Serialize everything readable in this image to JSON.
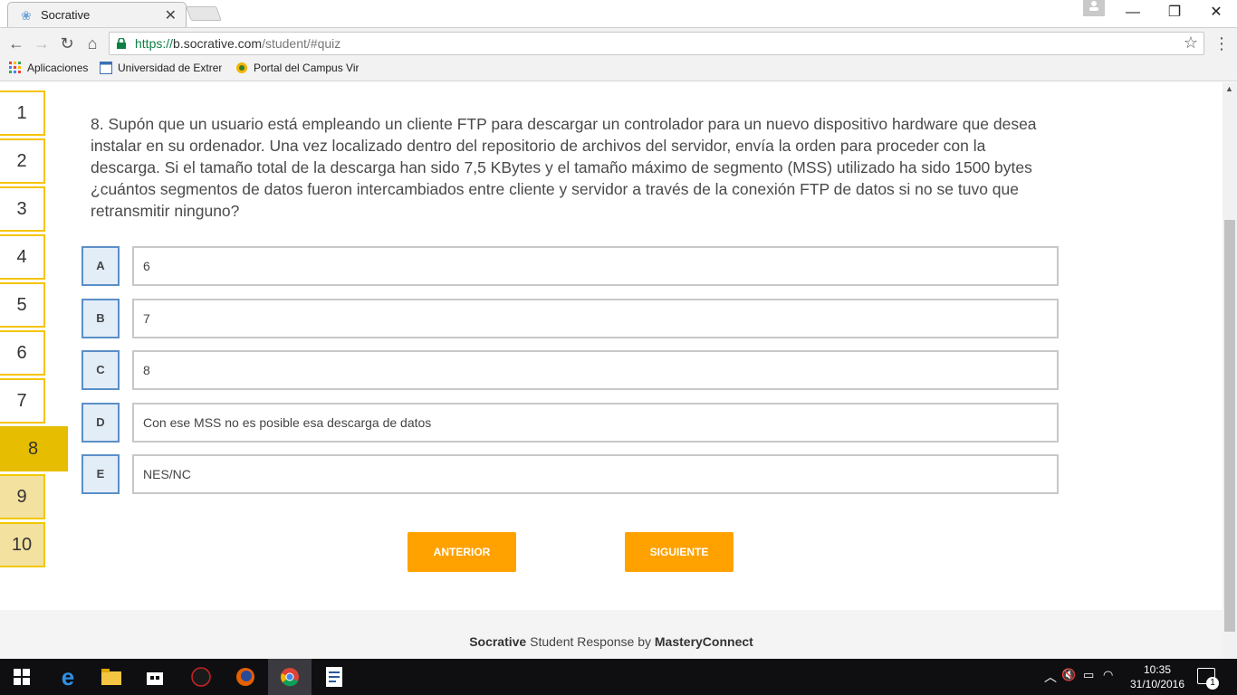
{
  "browser": {
    "tab_title": "Socrative",
    "tab_close": "✕",
    "url_scheme": "https://",
    "url_host": "b.socrative.com",
    "url_path": "/student/#quiz",
    "bookmarks": [
      {
        "label": "Aplicaciones"
      },
      {
        "label": "Universidad de Extrem"
      },
      {
        "label": "Portal del Campus Vir"
      }
    ],
    "win_min": "—",
    "win_max": "❐",
    "win_close": "✕"
  },
  "quiz_nav": [
    "1",
    "2",
    "3",
    "4",
    "5",
    "6",
    "7",
    "8",
    "9",
    "10"
  ],
  "current_question": 8,
  "question": {
    "text": "8. Supón que un usuario está empleando un cliente FTP para descargar un controlador para un nuevo dispositivo hardware que desea instalar en su ordenador. Una vez localizado dentro del repositorio de archivos del servidor, envía la orden para proceder con la descarga. Si el tamaño total de la descarga han sido 7,5 KBytes y el tamaño máximo de segmento (MSS) utilizado ha sido 1500 bytes ¿cuántos segmentos de datos fueron intercambiados entre cliente y servidor a través de la conexión FTP de datos si no se tuvo que retransmitir ninguno?"
  },
  "answers": [
    {
      "letter": "A",
      "text": "6"
    },
    {
      "letter": "B",
      "text": "7"
    },
    {
      "letter": "C",
      "text": "8"
    },
    {
      "letter": "D",
      "text": "Con ese MSS no es posible esa descarga de datos"
    },
    {
      "letter": "E",
      "text": "NES/NC"
    }
  ],
  "buttons": {
    "prev": "ANTERIOR",
    "next": "SIGUIENTE"
  },
  "footer": {
    "brand": "Socrative",
    "middle": " Student Response by ",
    "company": "MasteryConnect"
  },
  "taskbar": {
    "time": "10:35",
    "date": "31/10/2016",
    "notifications": "1"
  },
  "colors": {
    "accent": "#ffa200",
    "nav_border": "#f5c400",
    "answer_letter_border": "#5b8fc7"
  }
}
